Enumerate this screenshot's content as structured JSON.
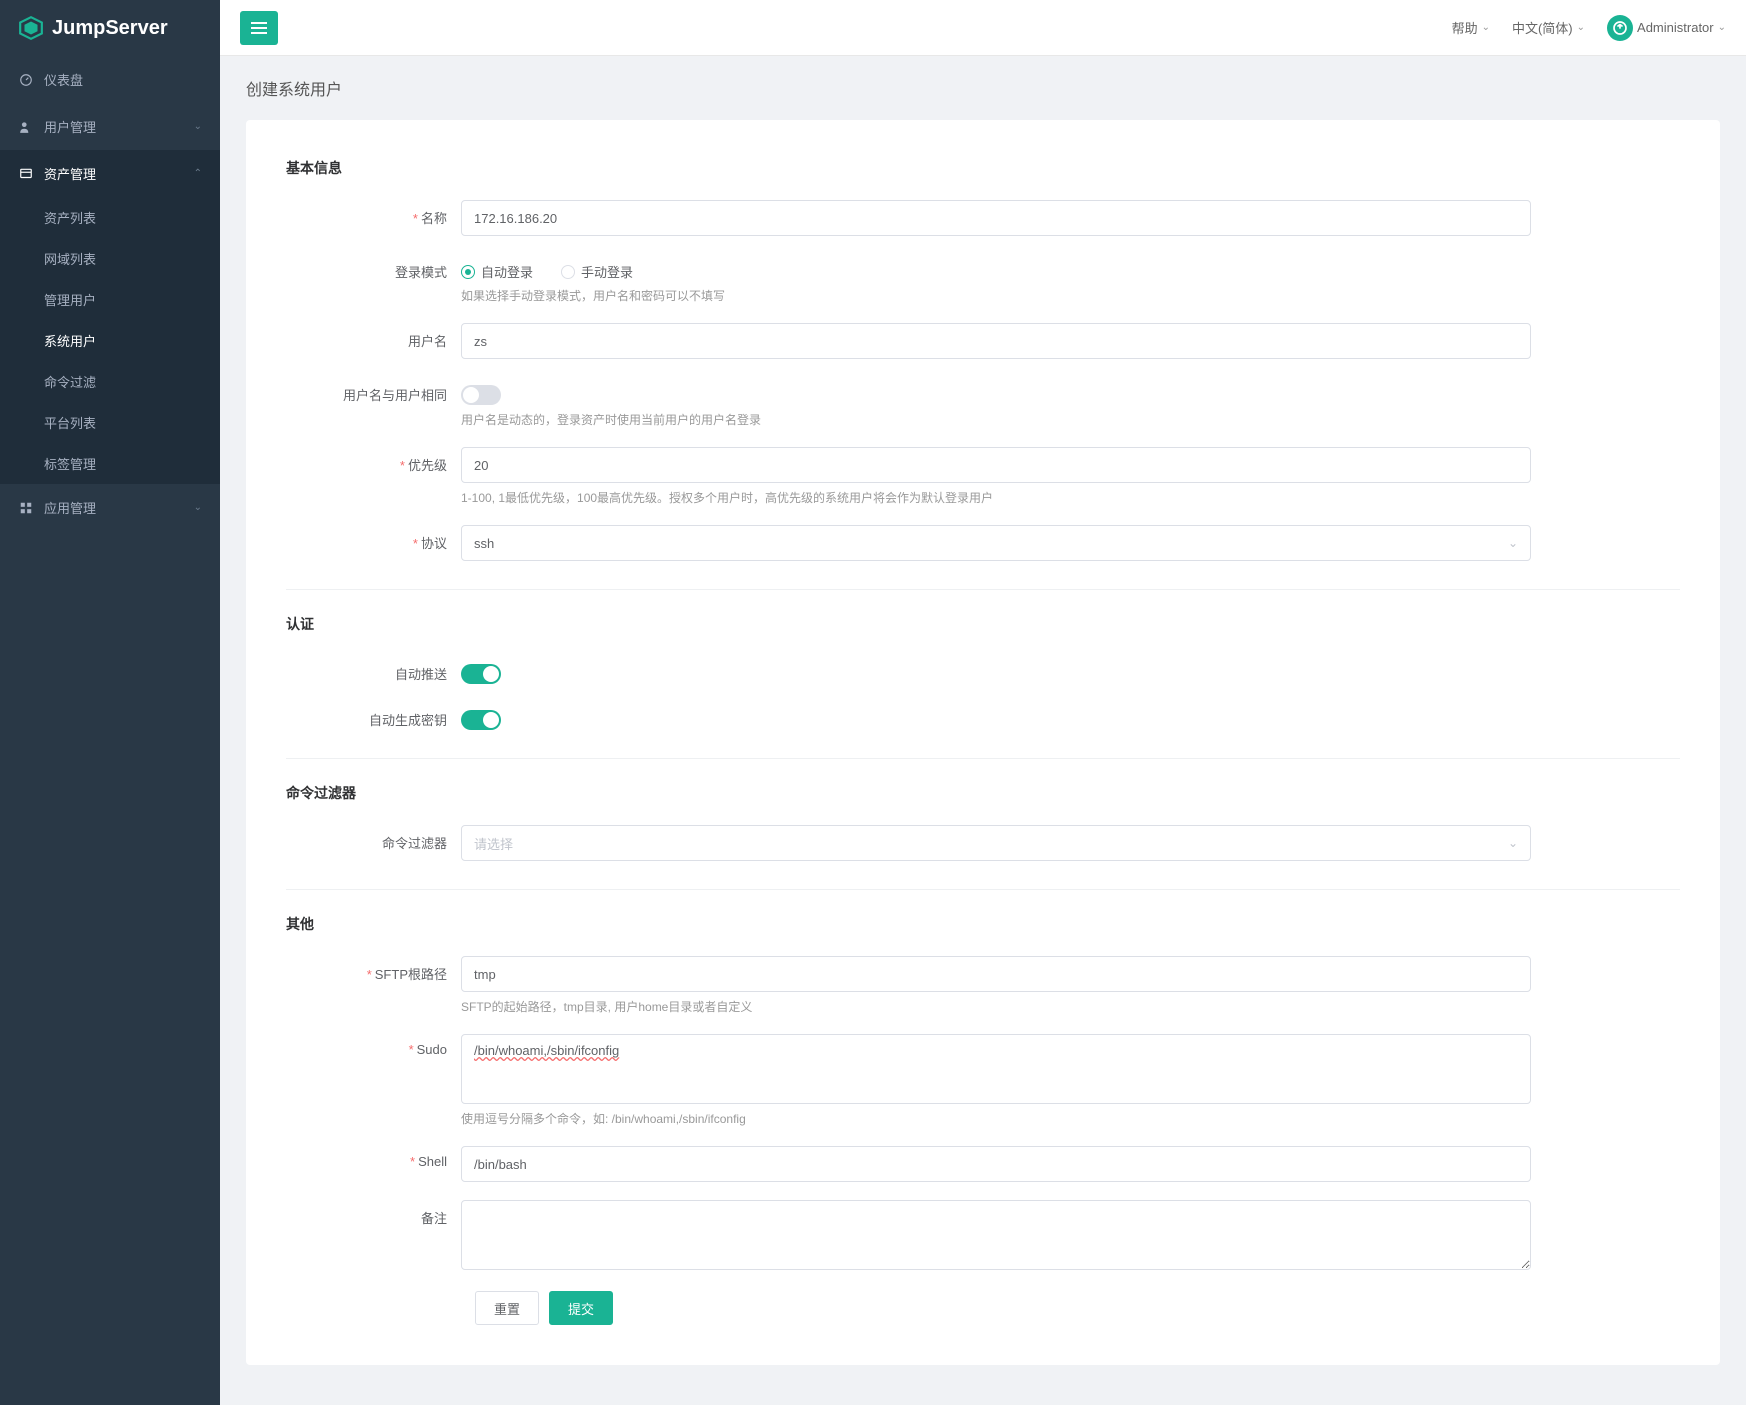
{
  "brand": "JumpServer",
  "topbar": {
    "help": "帮助",
    "lang": "中文(简体)",
    "user": "Administrator"
  },
  "sidebar": {
    "dashboard": "仪表盘",
    "user_mgmt": "用户管理",
    "asset_mgmt": "资产管理",
    "asset_children": {
      "asset_list": "资产列表",
      "domain_list": "网域列表",
      "admin_user": "管理用户",
      "system_user": "系统用户",
      "cmd_filter": "命令过滤",
      "platform_list": "平台列表",
      "label_mgmt": "标签管理"
    },
    "app_mgmt": "应用管理"
  },
  "page": {
    "title": "创建系统用户"
  },
  "sections": {
    "basic": "基本信息",
    "auth": "认证",
    "cmd_filter": "命令过滤器",
    "other": "其他"
  },
  "form": {
    "name": {
      "label": "名称",
      "value": "172.16.186.20"
    },
    "login_mode": {
      "label": "登录模式",
      "auto": "自动登录",
      "manual": "手动登录",
      "help": "如果选择手动登录模式，用户名和密码可以不填写"
    },
    "username": {
      "label": "用户名",
      "value": "zs"
    },
    "username_same": {
      "label": "用户名与用户相同",
      "help": "用户名是动态的，登录资产时使用当前用户的用户名登录"
    },
    "priority": {
      "label": "优先级",
      "value": "20",
      "help": "1-100, 1最低优先级，100最高优先级。授权多个用户时，高优先级的系统用户将会作为默认登录用户"
    },
    "protocol": {
      "label": "协议",
      "value": "ssh"
    },
    "auto_push": {
      "label": "自动推送"
    },
    "auto_gen_key": {
      "label": "自动生成密钥"
    },
    "cmd_filter": {
      "label": "命令过滤器",
      "placeholder": "请选择"
    },
    "sftp_root": {
      "label": "SFTP根路径",
      "value": "tmp",
      "help": "SFTP的起始路径，tmp目录, 用户home目录或者自定义"
    },
    "sudo": {
      "label": "Sudo",
      "value": "/bin/whoami,/sbin/ifconfig",
      "help": "使用逗号分隔多个命令，如: /bin/whoami,/sbin/ifconfig"
    },
    "shell": {
      "label": "Shell",
      "value": "/bin/bash"
    },
    "comment": {
      "label": "备注"
    }
  },
  "actions": {
    "reset": "重置",
    "submit": "提交"
  }
}
